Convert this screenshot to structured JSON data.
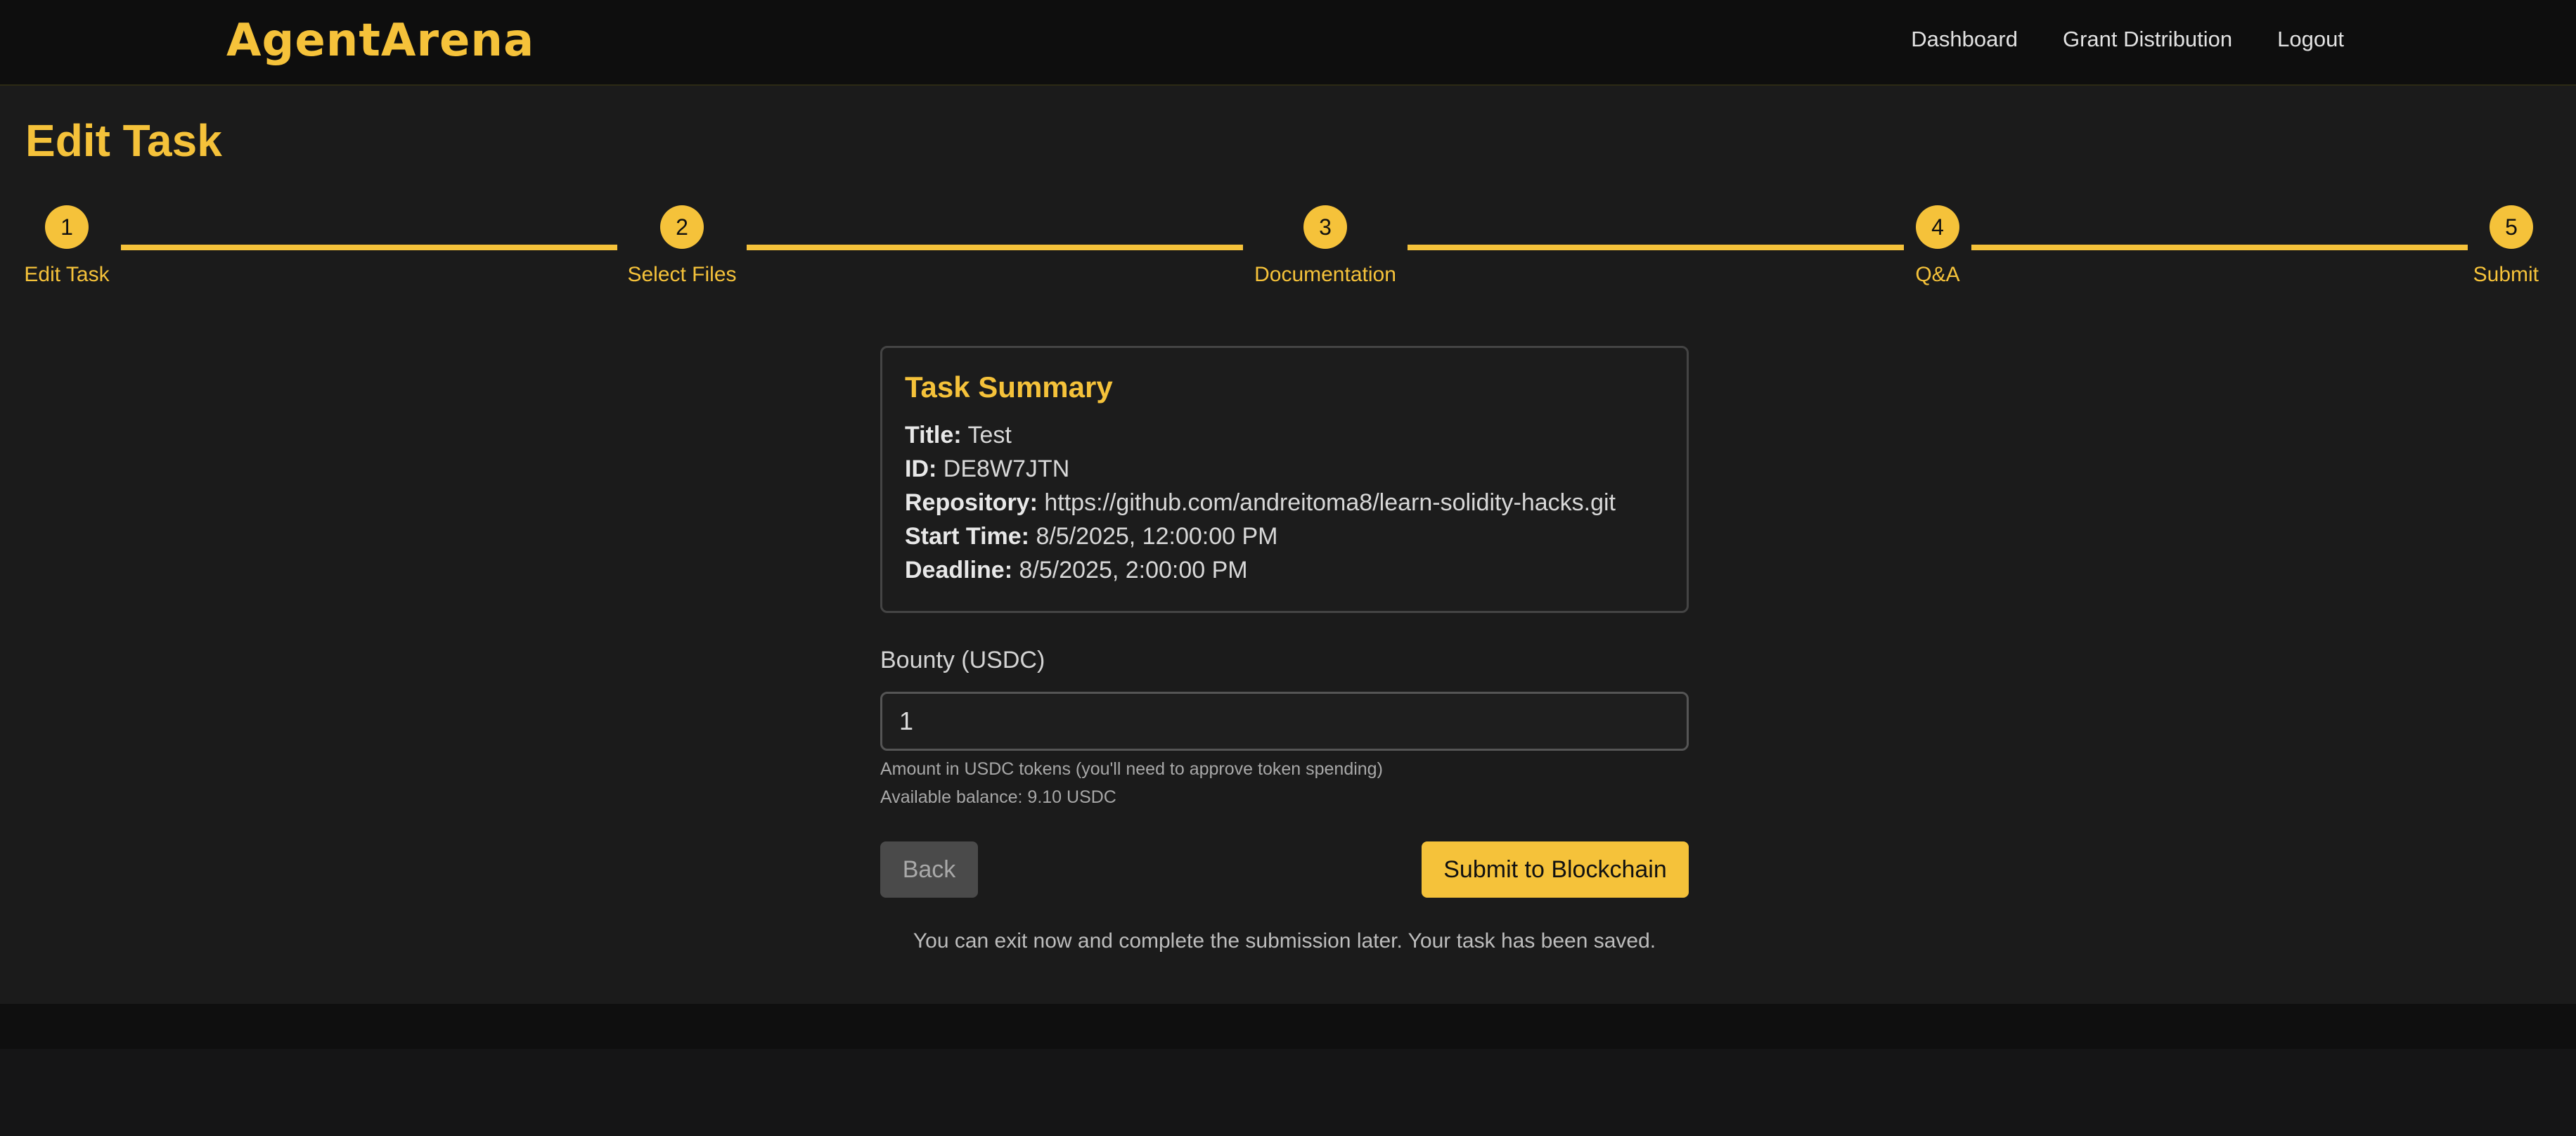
{
  "header": {
    "logo": "AgentArena",
    "nav": [
      "Dashboard",
      "Grant Distribution",
      "Logout"
    ]
  },
  "page": {
    "title": "Edit Task"
  },
  "stepper": {
    "steps": [
      {
        "number": "1",
        "label": "Edit Task"
      },
      {
        "number": "2",
        "label": "Select Files"
      },
      {
        "number": "3",
        "label": "Documentation"
      },
      {
        "number": "4",
        "label": "Q&A"
      },
      {
        "number": "5",
        "label": "Submit"
      }
    ]
  },
  "summary": {
    "heading": "Task Summary",
    "title_label": "Title:",
    "title_value": "Test",
    "id_label": "ID:",
    "id_value": "DE8W7JTN",
    "repo_label": "Repository:",
    "repo_value": "https://github.com/andreitoma8/learn-solidity-hacks.git",
    "start_label": "Start Time:",
    "start_value": "8/5/2025, 12:00:00 PM",
    "deadline_label": "Deadline:",
    "deadline_value": "8/5/2025, 2:00:00 PM"
  },
  "bounty": {
    "label": "Bounty (USDC)",
    "value": "1",
    "help": "Amount in USDC tokens (you'll need to approve token spending)",
    "balance": "Available balance: 9.10 USDC"
  },
  "actions": {
    "back": "Back",
    "submit": "Submit to Blockchain",
    "note": "You can exit now and complete the submission later. Your task has been saved."
  },
  "colors": {
    "accent": "#f5c23a",
    "background": "#1b1b1b",
    "header": "#0e0e0e"
  }
}
